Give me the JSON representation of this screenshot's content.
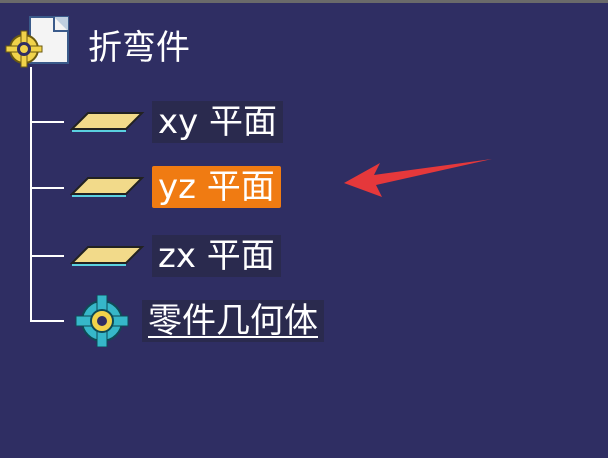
{
  "tree": {
    "root": {
      "label": "折弯件",
      "icon": "part-document-gear-icon"
    },
    "items": [
      {
        "label": "xy 平面",
        "icon": "plane-icon",
        "selected": false
      },
      {
        "label": "yz 平面",
        "icon": "plane-icon",
        "selected": true
      },
      {
        "label": "zx 平面",
        "icon": "plane-icon",
        "selected": false
      },
      {
        "label": "零件几何体",
        "icon": "part-body-gear-icon",
        "selected": false
      }
    ]
  },
  "colors": {
    "background": "#2f2e63",
    "selection": "#f07b12",
    "annotation_arrow": "#e5383b"
  }
}
